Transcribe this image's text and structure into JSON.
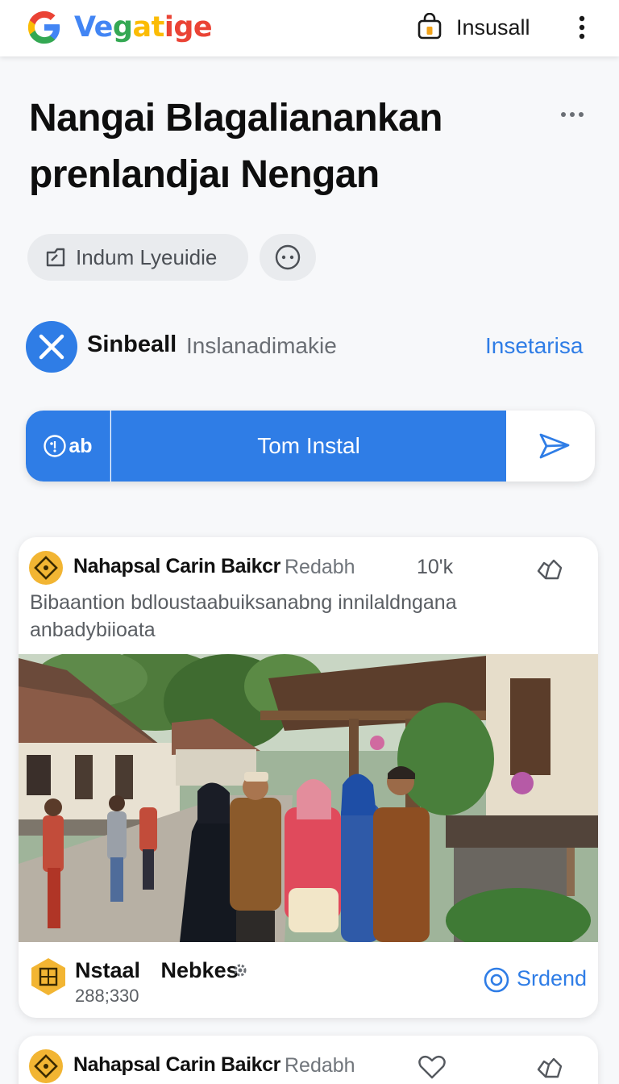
{
  "topbar": {
    "brand_parts": [
      "Ve",
      "g",
      "at",
      "ige"
    ],
    "install_label": "Insusall"
  },
  "article": {
    "title": "Nangai Blagalianankan prenlandjaı Nengan"
  },
  "chips": {
    "main_label": "Indum Lyeuidie"
  },
  "source": {
    "name": "Sinbeall",
    "subtitle": "Inslanadimakie",
    "link_label": "Insetarisa"
  },
  "action_bar": {
    "left_label": "ab",
    "main_label": "Tom Instal"
  },
  "post1": {
    "author": "Nahapsal  Carin Baikcr",
    "author_sub": "Redabh",
    "count": "10'k",
    "description": "Bibaantion bdloustaabuiksanabng innilaldngana anbadybiioata",
    "footer_title": "Nstaal  Nebkes",
    "footer_count": "288;330",
    "send_label": "Srdend"
  },
  "post2": {
    "author": "Nahapsal  Carin Baikcr",
    "author_sub": "Redabh"
  },
  "colors": {
    "accent": "#2f7de6",
    "badge_yellow": "#f2b533"
  }
}
